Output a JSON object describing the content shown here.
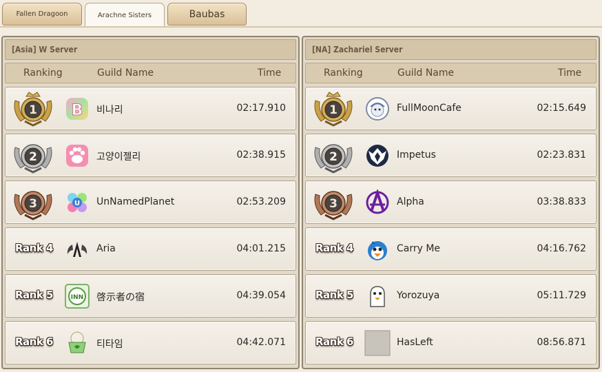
{
  "tabs": [
    {
      "label": "Fallen Dragoon",
      "active": false
    },
    {
      "label": "Arachne Sisters",
      "active": true
    },
    {
      "label": "Baubas",
      "active": false
    }
  ],
  "headers": {
    "ranking": "Ranking",
    "guild": "Guild Name",
    "time": "Time"
  },
  "servers": [
    {
      "title": "[Asia] W Server",
      "rows": [
        {
          "rank": "1",
          "guild": "비나리",
          "time": "02:17.910",
          "emblem": "letter-b-icon"
        },
        {
          "rank": "2",
          "guild": "고양이젤리",
          "time": "02:38.915",
          "emblem": "paw-icon"
        },
        {
          "rank": "3",
          "guild": "UnNamedPlanet",
          "time": "02:53.209",
          "emblem": "planet-flower-icon"
        },
        {
          "rank": "Rank 4",
          "guild": "Aria",
          "time": "04:01.215",
          "emblem": "wings-icon"
        },
        {
          "rank": "Rank 5",
          "guild": "啓示者の宿",
          "time": "04:39.054",
          "emblem": "inn-icon",
          "emblem_text": "INN"
        },
        {
          "rank": "Rank 6",
          "guild": "티타임",
          "time": "04:42.071",
          "emblem": "teacup-icon"
        }
      ]
    },
    {
      "title": "[NA] Zachariel Server",
      "rows": [
        {
          "rank": "1",
          "guild": "FullMoonCafe",
          "time": "02:15.649",
          "emblem": "moon-mascot-icon"
        },
        {
          "rank": "2",
          "guild": "Impetus",
          "time": "02:23.831",
          "emblem": "phoenix-icon"
        },
        {
          "rank": "3",
          "guild": "Alpha",
          "time": "03:38.833",
          "emblem": "anarchy-a-icon"
        },
        {
          "rank": "Rank 4",
          "guild": "Carry Me",
          "time": "04:16.762",
          "emblem": "penguin-icon"
        },
        {
          "rank": "Rank 5",
          "guild": "Yorozuya",
          "time": "05:11.729",
          "emblem": "ghost-duck-icon"
        },
        {
          "rank": "Rank 6",
          "guild": "HasLeft",
          "time": "08:56.871",
          "emblem": "blank-emblem-icon"
        }
      ]
    }
  ],
  "colors": {
    "gold": "#c9a24a",
    "silver": "#a9a9a9",
    "bronze": "#b07858",
    "medal_core": "#4a4440"
  }
}
